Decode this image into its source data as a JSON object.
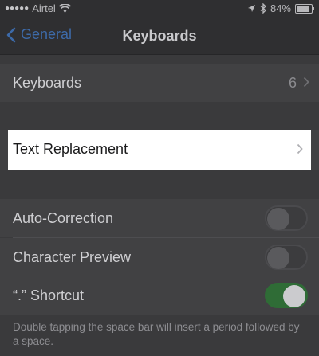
{
  "status_bar": {
    "carrier": "Airtel",
    "battery_text": "84%",
    "battery_level": 0.84
  },
  "nav": {
    "back_label": "General",
    "title": "Keyboards"
  },
  "rows": {
    "keyboards": {
      "label": "Keyboards",
      "value": "6"
    },
    "text_replacement": {
      "label": "Text Replacement"
    },
    "auto_correction": {
      "label": "Auto-Correction",
      "toggle": "off"
    },
    "character_preview": {
      "label": "Character Preview",
      "toggle": "off"
    },
    "shortcut": {
      "label": "“.” Shortcut",
      "toggle": "on"
    }
  },
  "footer_note": "Double tapping the space bar will insert a period followed by a space.",
  "colors": {
    "accent": "#3d6aa8",
    "toggle_on": "#2f6c36",
    "highlight": "#ffffff"
  }
}
